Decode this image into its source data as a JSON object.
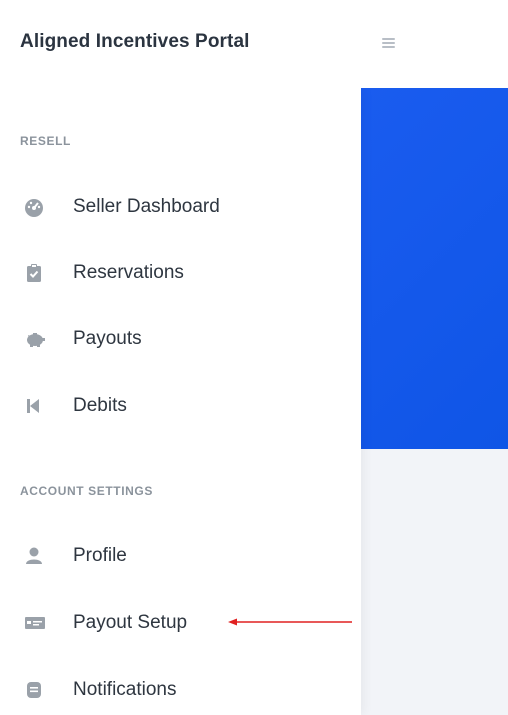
{
  "app": {
    "title": "Aligned Incentives Portal"
  },
  "sidebar": {
    "sections": [
      {
        "heading": "RESELL",
        "items": [
          {
            "label": "Seller Dashboard",
            "icon": "gauge-icon"
          },
          {
            "label": "Reservations",
            "icon": "clipboard-check-icon"
          },
          {
            "label": "Payouts",
            "icon": "piggy-bank-icon"
          },
          {
            "label": "Debits",
            "icon": "step-backward-icon"
          }
        ]
      },
      {
        "heading": "ACCOUNT SETTINGS",
        "items": [
          {
            "label": "Profile",
            "icon": "user-icon"
          },
          {
            "label": "Payout Setup",
            "icon": "money-check-icon"
          },
          {
            "label": "Notifications",
            "icon": "notification-icon"
          }
        ]
      }
    ]
  },
  "colors": {
    "hero_blue": "#1a5cef",
    "icon_gray": "#9aa1a9",
    "annotation_red": "#e02020"
  }
}
